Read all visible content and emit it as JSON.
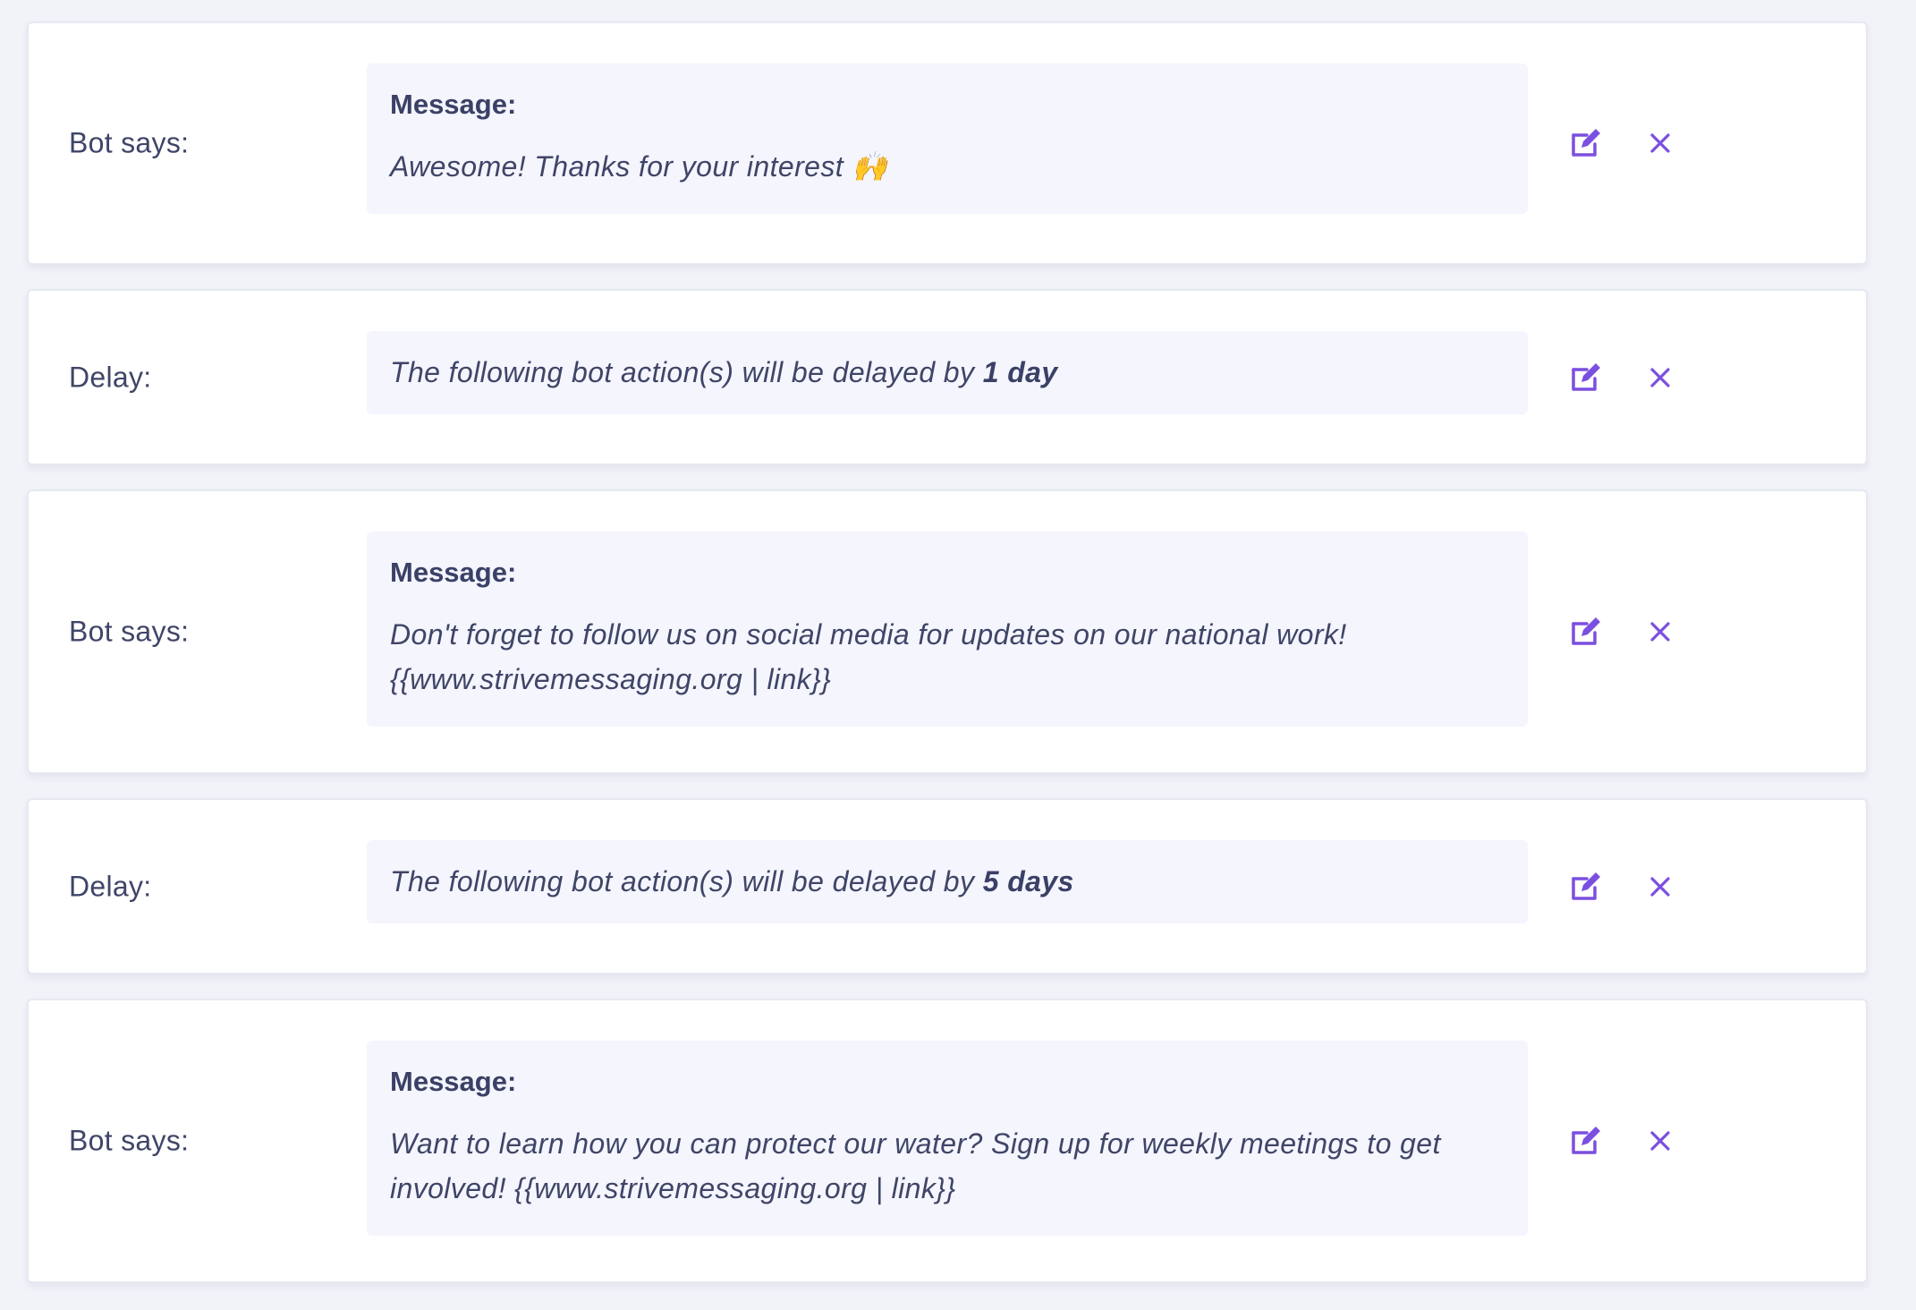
{
  "accent_color": "#7b4fe0",
  "steps": [
    {
      "type": "bot_says",
      "label": "Bot says:",
      "heading": "Message:",
      "body": "Awesome! Thanks for your interest 🙌"
    },
    {
      "type": "delay",
      "label": "Delay:",
      "prefix": "The following bot action(s) will be delayed by ",
      "duration": "1 day"
    },
    {
      "type": "bot_says",
      "label": "Bot says:",
      "heading": "Message:",
      "body": "Don't forget to follow us on social media for updates on our national work! {{www.strivemessaging.org | link}}"
    },
    {
      "type": "delay",
      "label": "Delay:",
      "prefix": "The following bot action(s) will be delayed by ",
      "duration": "5 days"
    },
    {
      "type": "bot_says",
      "label": "Bot says:",
      "heading": "Message:",
      "body": "Want to learn how you can protect our water? Sign up for weekly meetings to get involved! {{www.strivemessaging.org | link}}"
    }
  ],
  "icons": {
    "edit": "edit-icon",
    "delete": "close-icon"
  }
}
